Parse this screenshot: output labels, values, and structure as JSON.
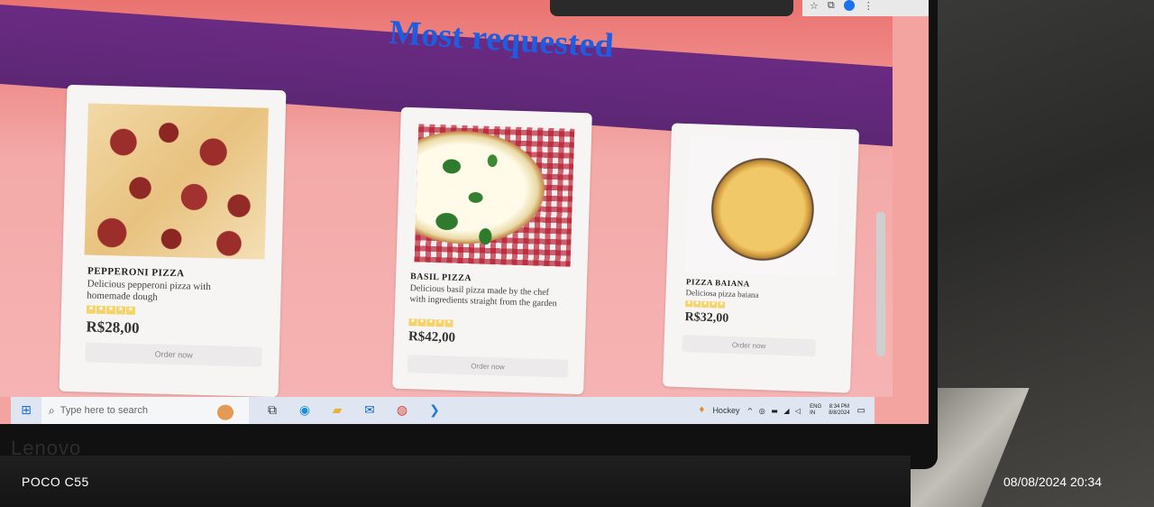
{
  "page": {
    "title": "Most requested"
  },
  "products": [
    {
      "name": "PEPPERONI PIZZA",
      "description": "Delicious pepperoni pizza with homemade dough",
      "rating": 5,
      "price": "R$28,00",
      "button": "Order now",
      "image": "pepperoni-pizza-photo"
    },
    {
      "name": "BASIL PIZZA",
      "description": "Delicious basil pizza made by the chef with ingredients straight from the garden",
      "rating": 5,
      "price": "R$42,00",
      "button": "Order now",
      "image": "basil-pizza-photo"
    },
    {
      "name": "PIZZA BAIANA",
      "description": "Deliciosa pizza baiana",
      "rating": 5,
      "price": "R$32,00",
      "button": "Order now",
      "image": "baiana-pizza-photo"
    }
  ],
  "taskbar": {
    "search_placeholder": "Type here to search",
    "weather": "Hockey",
    "language_top": "ENG",
    "language_bottom": "IN",
    "time": "8:34 PM",
    "date": "8/8/2024",
    "apps": [
      "task-view-icon",
      "edge-icon",
      "file-explorer-icon",
      "mail-icon",
      "chrome-icon",
      "vscode-icon"
    ]
  },
  "device": {
    "brand": "Lenovo"
  },
  "photo_watermark": {
    "camera": "POCO C55",
    "datetime": "08/08/2024  20:34"
  },
  "colors": {
    "title": "#1f5ce0",
    "header_band": "#5d2775",
    "page_bg": "#f3aaa8",
    "star": "#f3d36a"
  }
}
